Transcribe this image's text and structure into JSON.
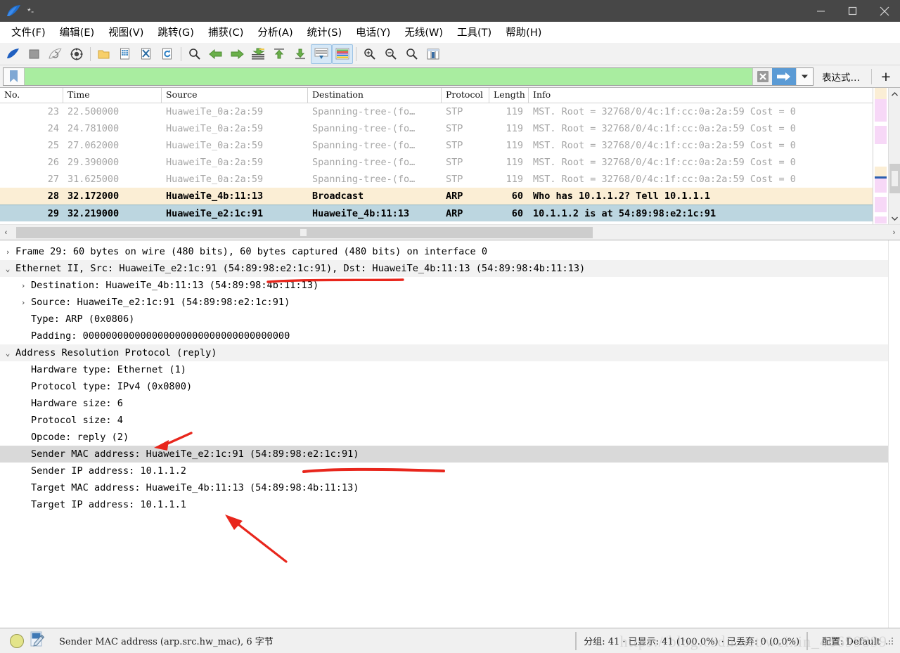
{
  "window": {
    "title": "*-",
    "logo_icon": "wireshark-shark-fin-icon",
    "minimize_icon": "minimize-icon",
    "maximize_icon": "maximize-icon",
    "close_icon": "close-icon"
  },
  "menu": [
    {
      "label": "文件(F)",
      "key": "F"
    },
    {
      "label": "编辑(E)",
      "key": "E"
    },
    {
      "label": "视图(V)",
      "key": "V"
    },
    {
      "label": "跳转(G)",
      "key": "G"
    },
    {
      "label": "捕获(C)",
      "key": "C"
    },
    {
      "label": "分析(A)",
      "key": "A"
    },
    {
      "label": "统计(S)",
      "key": "S"
    },
    {
      "label": "电话(Y)",
      "key": "Y"
    },
    {
      "label": "无线(W)",
      "key": "W"
    },
    {
      "label": "工具(T)",
      "key": "T"
    },
    {
      "label": "帮助(H)",
      "key": "H"
    }
  ],
  "toolbar": {
    "icons": [
      "start-capture-icon",
      "stop-capture-icon",
      "restart-capture-icon",
      "capture-options-icon",
      "open-file-icon",
      "save-file-icon",
      "close-file-icon",
      "reload-file-icon",
      "find-packet-icon",
      "go-back-icon",
      "go-forward-icon",
      "go-to-packet-icon",
      "go-to-first-icon",
      "go-to-last-icon",
      "auto-scroll-icon",
      "colorize-icon",
      "zoom-in-icon",
      "zoom-out-icon",
      "zoom-reset-icon",
      "resize-columns-icon"
    ]
  },
  "filter_bar": {
    "bookmark_icon": "bookmark-icon",
    "value": "",
    "placeholder": "",
    "clear_icon": "clear-filter-icon",
    "apply_icon": "apply-filter-arrow-icon",
    "dropdown_icon": "chevron-down-icon",
    "expression_label": "表达式…",
    "add_label": "+"
  },
  "packet_list": {
    "columns": [
      "No.",
      "Time",
      "Source",
      "Destination",
      "Protocol",
      "Length",
      "Info"
    ],
    "rows": [
      {
        "no": "23",
        "time": "22.500000",
        "src": "HuaweiTe_0a:2a:59",
        "dst": "Spanning-tree-(fo…",
        "proto": "STP",
        "len": "119",
        "info": "MST. Root = 32768/0/4c:1f:cc:0a:2a:59  Cost = 0",
        "state": "normal"
      },
      {
        "no": "24",
        "time": "24.781000",
        "src": "HuaweiTe_0a:2a:59",
        "dst": "Spanning-tree-(fo…",
        "proto": "STP",
        "len": "119",
        "info": "MST. Root = 32768/0/4c:1f:cc:0a:2a:59  Cost = 0",
        "state": "normal"
      },
      {
        "no": "25",
        "time": "27.062000",
        "src": "HuaweiTe_0a:2a:59",
        "dst": "Spanning-tree-(fo…",
        "proto": "STP",
        "len": "119",
        "info": "MST. Root = 32768/0/4c:1f:cc:0a:2a:59  Cost = 0",
        "state": "normal"
      },
      {
        "no": "26",
        "time": "29.390000",
        "src": "HuaweiTe_0a:2a:59",
        "dst": "Spanning-tree-(fo…",
        "proto": "STP",
        "len": "119",
        "info": "MST. Root = 32768/0/4c:1f:cc:0a:2a:59  Cost = 0",
        "state": "normal"
      },
      {
        "no": "27",
        "time": "31.625000",
        "src": "HuaweiTe_0a:2a:59",
        "dst": "Spanning-tree-(fo…",
        "proto": "STP",
        "len": "119",
        "info": "MST. Root = 32768/0/4c:1f:cc:0a:2a:59  Cost = 0",
        "state": "normal"
      },
      {
        "no": "28",
        "time": "32.172000",
        "src": "HuaweiTe_4b:11:13",
        "dst": "Broadcast",
        "proto": "ARP",
        "len": "60",
        "info": "Who has 10.1.1.2? Tell 10.1.1.1",
        "state": "highlight"
      },
      {
        "no": "29",
        "time": "32.219000",
        "src": "HuaweiTe_e2:1c:91",
        "dst": "HuaweiTe_4b:11:13",
        "proto": "ARP",
        "len": "60",
        "info": "10.1.1.2 is at 54:89:98:e2:1c:91",
        "state": "selected"
      }
    ]
  },
  "detail_tree": [
    {
      "text": "Frame 29: 60 bytes on wire (480 bits), 60 bytes captured (480 bits) on interface 0",
      "level": 1,
      "arrow": "collapsed",
      "style": "normal"
    },
    {
      "text": "Ethernet II, Src: HuaweiTe_e2:1c:91 (54:89:98:e2:1c:91), Dst: HuaweiTe_4b:11:13 (54:89:98:4b:11:13)",
      "level": 1,
      "arrow": "expanded",
      "style": "shade"
    },
    {
      "text": "Destination: HuaweiTe_4b:11:13 (54:89:98:4b:11:13)",
      "level": 2,
      "arrow": "collapsed",
      "style": "normal"
    },
    {
      "text": "Source: HuaweiTe_e2:1c:91 (54:89:98:e2:1c:91)",
      "level": 2,
      "arrow": "collapsed",
      "style": "normal"
    },
    {
      "text": "Type: ARP (0x0806)",
      "level": 2,
      "arrow": "none",
      "style": "normal"
    },
    {
      "text": "Padding: 000000000000000000000000000000000000",
      "level": 2,
      "arrow": "none",
      "style": "normal"
    },
    {
      "text": "Address Resolution Protocol (reply)",
      "level": 1,
      "arrow": "expanded",
      "style": "shade"
    },
    {
      "text": "Hardware type: Ethernet (1)",
      "level": 2,
      "arrow": "none",
      "style": "normal"
    },
    {
      "text": "Protocol type: IPv4 (0x0800)",
      "level": 2,
      "arrow": "none",
      "style": "normal"
    },
    {
      "text": "Hardware size: 6",
      "level": 2,
      "arrow": "none",
      "style": "normal"
    },
    {
      "text": "Protocol size: 4",
      "level": 2,
      "arrow": "none",
      "style": "normal"
    },
    {
      "text": "Opcode: reply (2)",
      "level": 2,
      "arrow": "none",
      "style": "normal"
    },
    {
      "text": "Sender MAC address: HuaweiTe_e2:1c:91 (54:89:98:e2:1c:91)",
      "level": 2,
      "arrow": "none",
      "style": "hl"
    },
    {
      "text": "Sender IP address: 10.1.1.2",
      "level": 2,
      "arrow": "none",
      "style": "normal"
    },
    {
      "text": "Target MAC address: HuaweiTe_4b:11:13 (54:89:98:4b:11:13)",
      "level": 2,
      "arrow": "none",
      "style": "normal"
    },
    {
      "text": "Target IP address: 10.1.1.1",
      "level": 2,
      "arrow": "none",
      "style": "normal"
    }
  ],
  "annotations": {
    "color": "#e8261c",
    "marks": [
      {
        "kind": "underline",
        "target": "ethernet-src-mac"
      },
      {
        "kind": "arrow",
        "target": "opcode-reply"
      },
      {
        "kind": "underline",
        "target": "sender-mac-address"
      },
      {
        "kind": "arrow",
        "target": "target-ip-address"
      }
    ]
  },
  "status_bar": {
    "expert_icon": "expert-info-yellow-icon",
    "file_icon": "capture-file-properties-icon",
    "field_text": "Sender MAC address (arp.src.hw_mac), 6 字节",
    "stats_text": "分组: 41 · 已显示: 41 (100.0%) · 已丢弃: 0 (0.0%)",
    "profile_text": "配置: Default",
    "watermark": "https://blog.csdn.net/weixin_46699899"
  }
}
